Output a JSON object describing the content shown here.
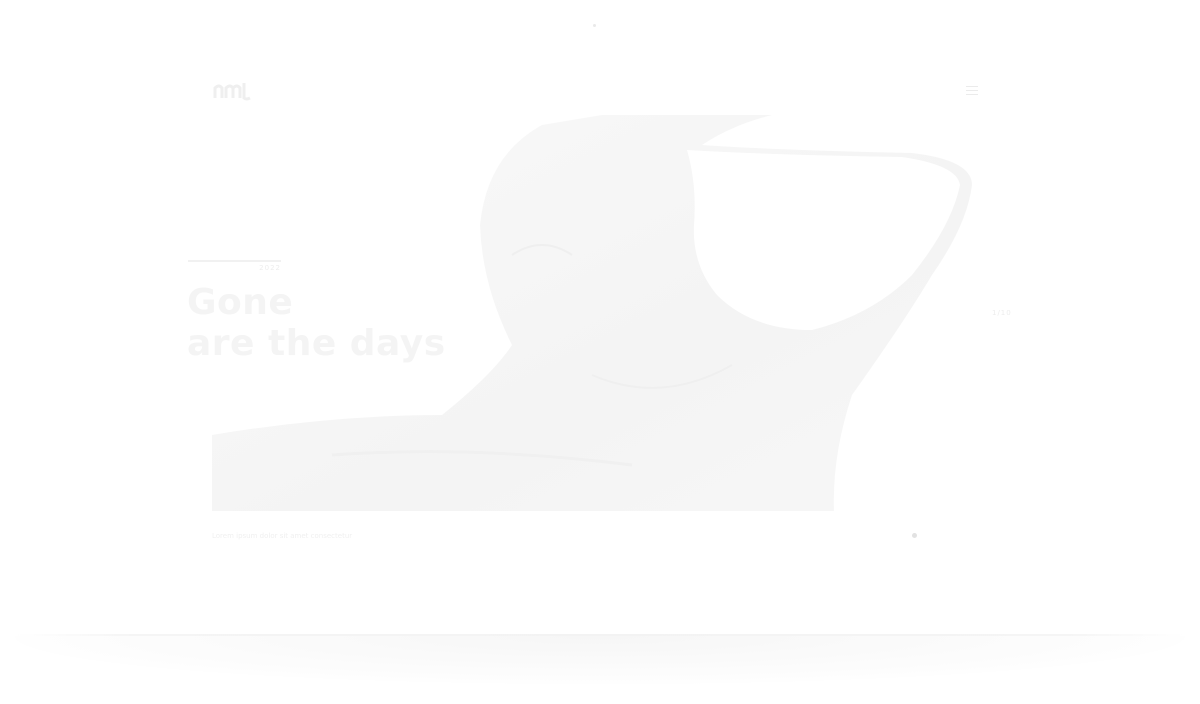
{
  "header": {
    "logo_icon": "logo-mark",
    "menu_icon": "hamburger-icon"
  },
  "hero": {
    "kicker": "2022",
    "title_line1": "Gone",
    "title_line2": "are the days",
    "side_label": "1/10",
    "image_subject": "figure-with-arms-raised"
  },
  "footer": {
    "caption": "Lorem ipsum dolor sit amet consectetur"
  },
  "colors": {
    "background": "#ffffff",
    "text_faint": "#f4f4f4",
    "image_tone": "#f6f6f6"
  }
}
